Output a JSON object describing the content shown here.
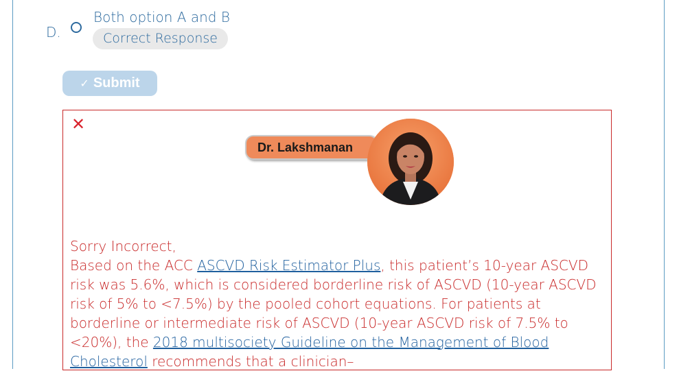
{
  "option": {
    "letter": "D.",
    "text": "Both option A and B",
    "badge": "Correct Response"
  },
  "submit": {
    "label": "Submit",
    "icon": "check-icon"
  },
  "feedback": {
    "close_icon": "close-icon",
    "presenter_name": "Dr. Lakshmanan",
    "heading": "Sorry Incorrect,",
    "p1": "Based on the ACC ",
    "link1": "ASCVD Risk Estimator Plus",
    "p2": ", this patient’s 10-year ASCVD risk was 5.6%, which is considered borderline risk of ASCVD (10-year ASCVD risk of 5% to <7.5%) by the pooled cohort equations. For patients at borderline or intermediate risk of ASCVD (10-year ASCVD risk of 7.5% to <20%), the ",
    "link2": "2018 multisociety Guideline on the Management of Blood Cholesterol",
    "p3": " recommends that a clinician–"
  },
  "colors": {
    "accent": "#2d6a9e",
    "error": "#c82828",
    "badge_bg": "#e9e9e9",
    "submit_bg": "#bcd5ea",
    "name_tag_bg": "#ef8a5a"
  }
}
